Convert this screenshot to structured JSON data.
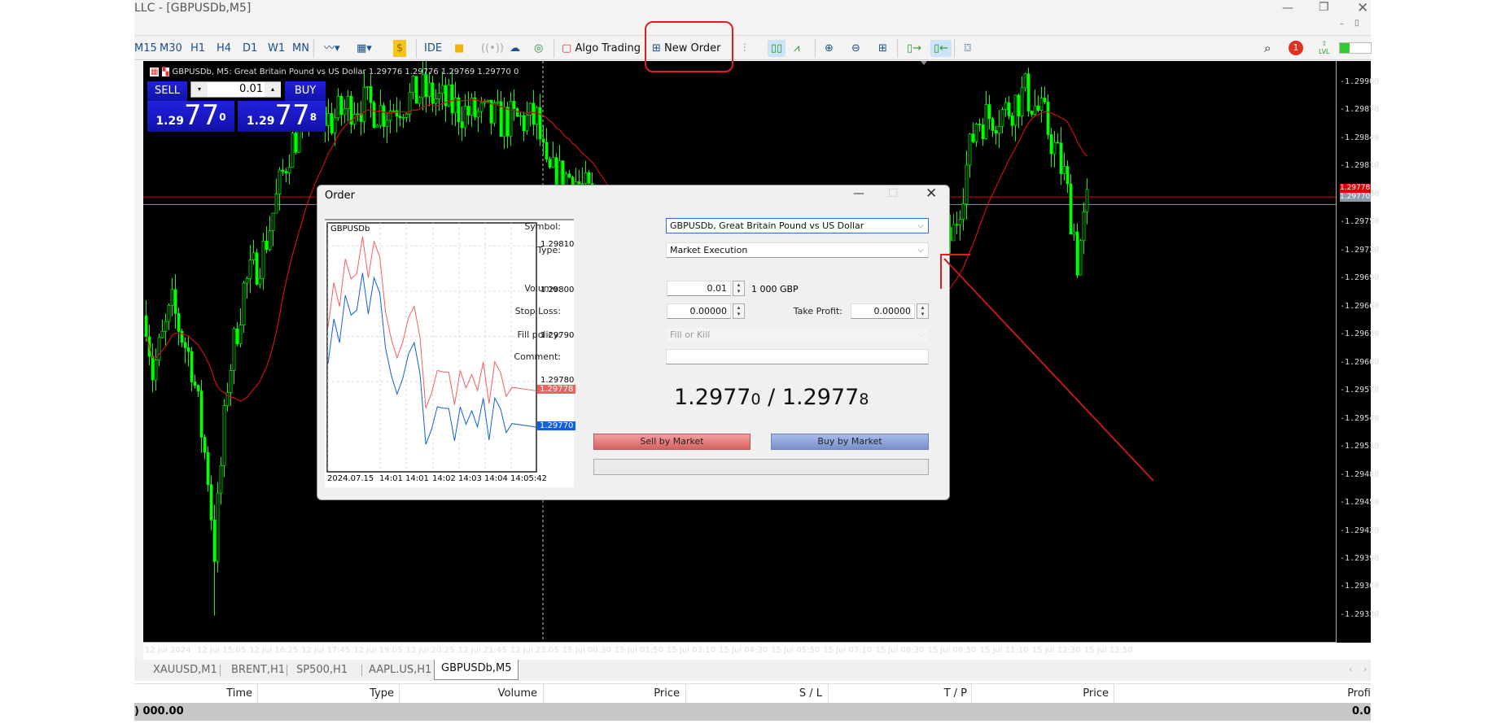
{
  "window": {
    "title": "LLC - [GBPUSDb,M5]"
  },
  "toolbar": {
    "timeframes": [
      "M15",
      "M30",
      "H1",
      "H4",
      "D1",
      "W1",
      "MN"
    ],
    "ide_label": "IDE",
    "algo_trading_label": "Algo Trading",
    "new_order_label": "New Order",
    "notification_count": "1",
    "lvl_label": "LVL"
  },
  "chart": {
    "info": "GBPUSDb, M5:  Great Britain Pound vs US Dollar  1.29776 1.29776 1.29769 1.29770  0",
    "one_click": {
      "sell_label": "SELL",
      "buy_label": "BUY",
      "volume": "0.01",
      "sell_prefix": "1.29",
      "sell_big": "77",
      "sell_sup": "0",
      "buy_prefix": "1.29",
      "buy_big": "77",
      "buy_sup": "8"
    },
    "ask_tag": "1.29778",
    "bid_tag": "1.29770"
  },
  "chart_data": {
    "type": "candlestick",
    "symbol": "GBPUSDb",
    "timeframe": "M5",
    "price_ticks": [
      "1.29900",
      "1.29870",
      "1.29840",
      "1.29810",
      "1.29780",
      "1.29750",
      "1.29720",
      "1.29690",
      "1.29660",
      "1.29630",
      "1.29600",
      "1.29570",
      "1.29540",
      "1.29510",
      "1.29480",
      "1.29450",
      "1.29420",
      "1.29390",
      "1.29360",
      "1.29330"
    ],
    "time_ticks": [
      "12 Jul 2024",
      "12 Jul 15:05",
      "12 Jul 16:25",
      "12 Jul 17:45",
      "12 Jul 19:05",
      "12 Jul 20:25",
      "12 Jul 21:45",
      "12 Jul 23:05",
      "15 Jul 00:30",
      "15 Jul 01:50",
      "15 Jul 03:10",
      "15 Jul 04:30",
      "15 Jul 05:50",
      "15 Jul 07:10",
      "15 Jul 08:30",
      "15 Jul 09:50",
      "15 Jul 11:10",
      "15 Jul 12:30",
      "15 Jul 13:50"
    ],
    "ylim": [
      1.2931,
      1.2991
    ],
    "approx_path_bar_price": [
      [
        0,
        1.29651
      ],
      [
        2,
        1.2959
      ],
      [
        8,
        1.2966
      ],
      [
        14,
        1.296
      ],
      [
        19,
        1.2948
      ],
      [
        21,
        1.294
      ],
      [
        25,
        1.2958
      ],
      [
        30,
        1.2968
      ],
      [
        36,
        1.2972
      ],
      [
        44,
        1.2983
      ],
      [
        50,
        1.2987
      ],
      [
        57,
        1.2986
      ],
      [
        64,
        1.2988
      ],
      [
        73,
        1.2987
      ],
      [
        85,
        1.2989
      ],
      [
        97,
        1.2987
      ],
      [
        108,
        1.2986
      ],
      [
        120,
        1.2986
      ],
      [
        123,
        1.298
      ],
      [
        131,
        1.298
      ],
      [
        150,
        1.2972
      ],
      [
        180,
        1.2962
      ],
      [
        210,
        1.296
      ],
      [
        235,
        1.2966
      ],
      [
        248,
        1.2974
      ],
      [
        252,
        1.2981
      ],
      [
        255,
        1.2986
      ],
      [
        264,
        1.2987
      ],
      [
        270,
        1.2989
      ],
      [
        276,
        1.2986
      ],
      [
        282,
        1.298
      ],
      [
        285,
        1.2974
      ],
      [
        286,
        1.2971
      ],
      [
        289,
        1.2977
      ]
    ],
    "colors": {
      "candles": "#00ff00",
      "ma": "#d01010",
      "ask_line": "#e00000",
      "bid_line": "#8a9aa8"
    }
  },
  "tabs": [
    {
      "label": "XAUUSD,M1",
      "active": false
    },
    {
      "label": "BRENT,H1",
      "active": false
    },
    {
      "label": "SP500,H1",
      "active": false
    },
    {
      "label": "AAPL.US,H1",
      "active": false
    },
    {
      "label": "GBPUSDb,M5",
      "active": true
    }
  ],
  "table": {
    "headers": [
      "Time",
      "Type",
      "Volume",
      "Price",
      "S / L",
      "T / P",
      "Price",
      "Profi"
    ],
    "balance_row": {
      "left": ") 000.00",
      "right": "0.0"
    }
  },
  "order_dialog": {
    "title": "Order",
    "mini_chart": {
      "symbol": "GBPUSDb",
      "price_ticks": [
        "1.29810",
        "1.29800",
        "1.29790",
        "1.29780"
      ],
      "time_ticks": [
        "2024.07.15",
        "14:01",
        "14:01",
        "14:02",
        "14:03",
        "14:04",
        "14:05:42"
      ],
      "bid_series": [
        1.29785,
        1.29794,
        1.29789,
        1.298,
        1.29794,
        1.29796,
        1.29804,
        1.29795,
        1.29803,
        1.298,
        1.29788,
        1.29781,
        1.29778,
        1.29781,
        1.29786,
        1.29788,
        1.29782,
        1.29767,
        1.2977,
        1.29774,
        1.29774,
        1.29774,
        1.29767,
        1.29775,
        1.29771,
        1.29773,
        1.29771,
        1.29777,
        1.29767,
        1.29776,
        1.29775,
        1.29769,
        1.2977
      ],
      "spread": 8e-05,
      "ask_tag": "1.29778",
      "bid_tag": "1.29770",
      "colors": {
        "ask": "#f06060",
        "bid": "#1060e0"
      }
    },
    "symbol_label": "Symbol:",
    "symbol_value": "GBPUSDb, Great Britain Pound vs US Dollar",
    "type_label": "Type:",
    "type_value": "Market Execution",
    "volume_label": "Volume:",
    "volume_value": "0.01",
    "volume_hint": "1 000 GBP",
    "stop_loss_label": "Stop Loss:",
    "stop_loss_value": "0.00000",
    "take_profit_label": "Take Profit:",
    "take_profit_value": "0.00000",
    "fill_policy_label": "Fill policy:",
    "fill_policy_value": "Fill or Kill",
    "comment_label": "Comment:",
    "comment_value": "",
    "bid_main": "1.2977",
    "bid_last": "0",
    "separator": " / ",
    "ask_main": "1.2977",
    "ask_last": "8",
    "sell_button": "Sell by Market",
    "buy_button": "Buy by Market"
  },
  "annotations": {
    "color": "#e02020"
  }
}
